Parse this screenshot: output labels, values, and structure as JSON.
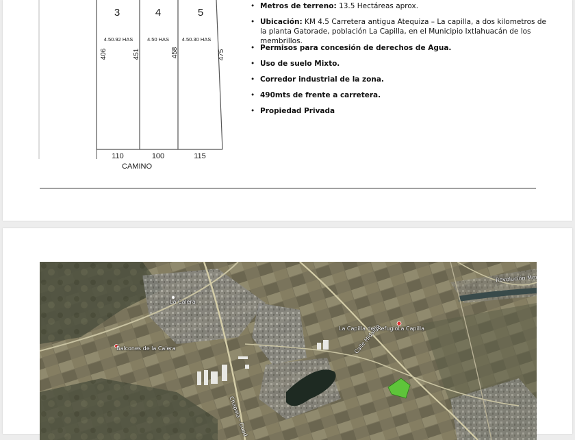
{
  "plan": {
    "lots": [
      {
        "number": "3",
        "area": "4.50.92 HAS",
        "side_left": "406",
        "side_right": "451",
        "front": "110"
      },
      {
        "number": "4",
        "area": "4.50 HAS",
        "side_right": "458",
        "front": "100"
      },
      {
        "number": "5",
        "area": "4.50.30 HAS",
        "side_right": "475",
        "front": "115"
      }
    ],
    "road_label": "CAMINO"
  },
  "features": [
    {
      "label": "Metros de terreno:",
      "text": " 13.5 Hectáreas aprox."
    },
    {
      "label": "Ubicación:",
      "text": " KM 4.5 Carretera antigua Atequiza – La capilla, a dos kilometros de la planta Gatorade, población La Capilla, en el Municipio Ixtlahuacán de los membrillos."
    },
    {
      "label": "Permisos para concesión de derechos de Agua.",
      "text": ""
    },
    {
      "label": "Uso de suelo Mixto.",
      "text": ""
    },
    {
      "label": "Corredor industrial de la zona.",
      "text": ""
    },
    {
      "label": "490mts de frente a carretera.",
      "text": ""
    },
    {
      "label": "Propiedad Privada",
      "text": ""
    }
  ],
  "map": {
    "labels": {
      "la_calera": "La Calera",
      "balcones": "Balcones de la Calera",
      "capilla_refugio": "La Capilla del Refugio",
      "la_capilla": "La Capilla",
      "calle_hidalgo": "Calle Hidalgo",
      "revolucion": "Revolución Mexi",
      "chapala": "Chapala - Guad"
    },
    "colors": {
      "property": "#5ec43a",
      "pin": "#e03030"
    }
  }
}
